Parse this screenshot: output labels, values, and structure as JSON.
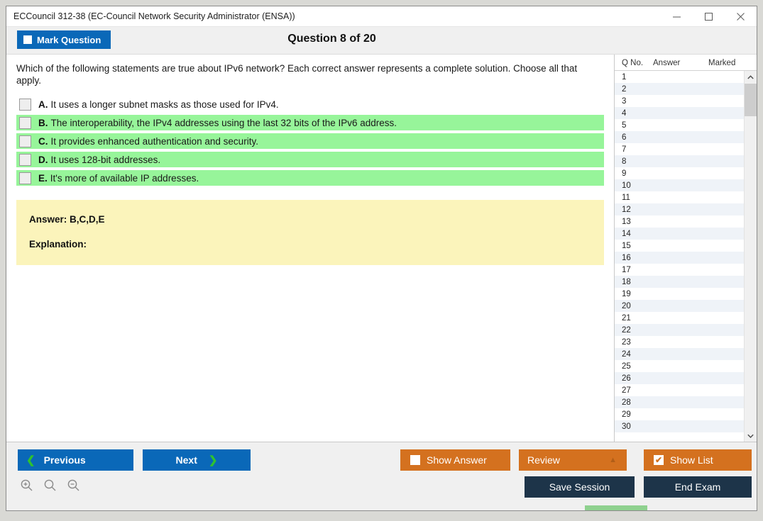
{
  "window": {
    "title": "ECCouncil 312-38 (EC-Council Network Security Administrator (ENSA))",
    "minimize_label": "minimize",
    "maximize_label": "maximize",
    "close_label": "close"
  },
  "header": {
    "mark_question_label": "Mark Question",
    "question_title": "Question 8 of 20",
    "current_question": 8,
    "total_questions": 20
  },
  "question": {
    "text": "Which of the following statements are true about IPv6 network? Each correct answer represents a complete solution. Choose all that apply.",
    "options": [
      {
        "letter": "A.",
        "text": "It uses a longer subnet masks as those used for IPv4.",
        "correct": false,
        "checked": false
      },
      {
        "letter": "B.",
        "text": "The interoperability, the IPv4 addresses using the last 32 bits of the IPv6 address.",
        "correct": true,
        "checked": false
      },
      {
        "letter": "C.",
        "text": "It provides enhanced authentication and security.",
        "correct": true,
        "checked": false
      },
      {
        "letter": "D.",
        "text": "It uses 128-bit addresses.",
        "correct": true,
        "checked": false
      },
      {
        "letter": "E.",
        "text": "It's more of available IP addresses.",
        "correct": true,
        "checked": false
      }
    ]
  },
  "answer_panel": {
    "answer_label": "Answer: B,C,D,E",
    "explanation_label": "Explanation:"
  },
  "question_list": {
    "columns": [
      "Q No.",
      "Answer",
      "Marked"
    ],
    "rows": [
      {
        "no": "1",
        "answer": "",
        "marked": ""
      },
      {
        "no": "2",
        "answer": "",
        "marked": ""
      },
      {
        "no": "3",
        "answer": "",
        "marked": ""
      },
      {
        "no": "4",
        "answer": "",
        "marked": ""
      },
      {
        "no": "5",
        "answer": "",
        "marked": ""
      },
      {
        "no": "6",
        "answer": "",
        "marked": ""
      },
      {
        "no": "7",
        "answer": "",
        "marked": ""
      },
      {
        "no": "8",
        "answer": "",
        "marked": ""
      },
      {
        "no": "9",
        "answer": "",
        "marked": ""
      },
      {
        "no": "10",
        "answer": "",
        "marked": ""
      },
      {
        "no": "11",
        "answer": "",
        "marked": ""
      },
      {
        "no": "12",
        "answer": "",
        "marked": ""
      },
      {
        "no": "13",
        "answer": "",
        "marked": ""
      },
      {
        "no": "14",
        "answer": "",
        "marked": ""
      },
      {
        "no": "15",
        "answer": "",
        "marked": ""
      },
      {
        "no": "16",
        "answer": "",
        "marked": ""
      },
      {
        "no": "17",
        "answer": "",
        "marked": ""
      },
      {
        "no": "18",
        "answer": "",
        "marked": ""
      },
      {
        "no": "19",
        "answer": "",
        "marked": ""
      },
      {
        "no": "20",
        "answer": "",
        "marked": ""
      },
      {
        "no": "21",
        "answer": "",
        "marked": ""
      },
      {
        "no": "22",
        "answer": "",
        "marked": ""
      },
      {
        "no": "23",
        "answer": "",
        "marked": ""
      },
      {
        "no": "24",
        "answer": "",
        "marked": ""
      },
      {
        "no": "25",
        "answer": "",
        "marked": ""
      },
      {
        "no": "26",
        "answer": "",
        "marked": ""
      },
      {
        "no": "27",
        "answer": "",
        "marked": ""
      },
      {
        "no": "28",
        "answer": "",
        "marked": ""
      },
      {
        "no": "29",
        "answer": "",
        "marked": ""
      },
      {
        "no": "30",
        "answer": "",
        "marked": ""
      }
    ]
  },
  "footer": {
    "previous_label": "Previous",
    "next_label": "Next",
    "show_answer_label": "Show Answer",
    "show_answer_checked": false,
    "review_label": "Review",
    "show_list_label": "Show List",
    "show_list_checked": true,
    "show_list_check_glyph": "✔",
    "save_session_label": "Save Session",
    "end_exam_label": "End Exam",
    "zoom_in_label": "zoom-in",
    "zoom_reset_label": "zoom-reset",
    "zoom_out_label": "zoom-out"
  },
  "colors": {
    "primary_blue": "#0a68b8",
    "orange": "#d4711f",
    "navy": "#1d3449",
    "correct_green": "#97f59a",
    "answer_yellow": "#fbf4bb",
    "chevron_green": "#2fc22f"
  }
}
